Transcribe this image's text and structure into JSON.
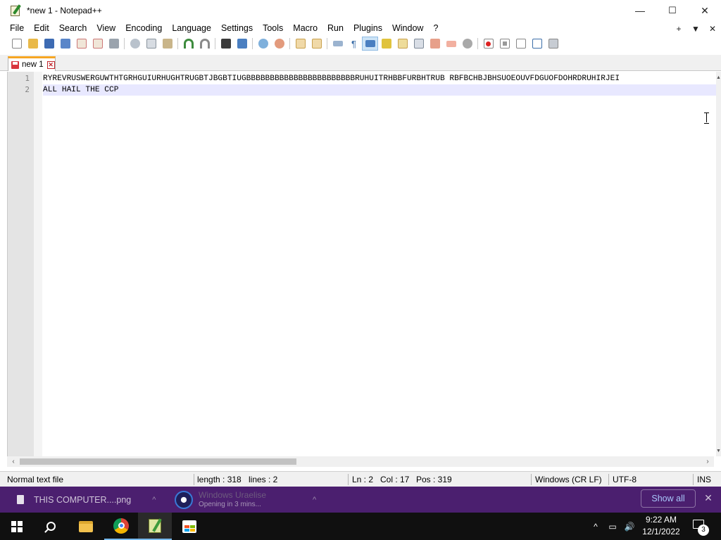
{
  "window": {
    "title": "*new 1 - Notepad++",
    "controls": {
      "minimize": "—",
      "maximize": "☐",
      "close": "✕"
    }
  },
  "menu": {
    "items": [
      "File",
      "Edit",
      "Search",
      "View",
      "Encoding",
      "Language",
      "Settings",
      "Tools",
      "Macro",
      "Run",
      "Plugins",
      "Window",
      "?"
    ],
    "right": {
      "add": "+",
      "dropdown": "▼",
      "close": "✕"
    }
  },
  "toolbar": {
    "icons": [
      "new-file",
      "open-file",
      "save",
      "save-all",
      "close",
      "close-all",
      "print",
      "cut",
      "copy",
      "paste",
      "undo",
      "redo",
      "find",
      "replace",
      "zoom-in",
      "zoom-out",
      "sync-vertical",
      "sync-horizontal",
      "word-wrap",
      "show-all-chars",
      "indent-guide",
      "user-defined-language",
      "doc-map",
      "function-list",
      "folder-as-workspace",
      "monitoring",
      "record-macro",
      "stop-recording",
      "playback",
      "run-macro-multiple",
      "save-macro"
    ],
    "active_icon": "indent-guide"
  },
  "tabs": [
    {
      "label": "new 1",
      "close": "✕"
    }
  ],
  "editor": {
    "lines": [
      {
        "number": "1",
        "text": "RYREVRUSWERGUWTHTGRHGUIURHUGHTRUGBTJBGBTIUGBBBBBBBBBBBBBBBBBBBBBBBRUHUITRHBBFURBHTRUB RBFBCHBJBHSUOEOUVFDGUOFDOHRDRUHIRJEI"
      },
      {
        "number": "2",
        "text": "ALL HAIL THE CCP"
      }
    ],
    "current_line": 2
  },
  "status": {
    "file_type": "Normal text file",
    "length": "length : 318",
    "lines": "lines : 2",
    "ln": "Ln : 2",
    "col": "Col : 17",
    "pos": "Pos : 319",
    "eol": "Windows (CR LF)",
    "encoding": "UTF-8",
    "mode": "INS"
  },
  "downloads": {
    "file_name": "THIS COMPUTER....png",
    "update_title": "Windows Uraelise",
    "update_status": "Opening in 3 mins...",
    "show_all": "Show all",
    "close": "✕",
    "caret": "^"
  },
  "taskbar": {
    "time": "9:22 AM",
    "date": "12/1/2022",
    "notification_count": "3",
    "tray_chevron": "^",
    "tray_network": "▭",
    "tray_volume": "🔊"
  },
  "colors": {
    "tab_accent": "#f6a623",
    "current_line": "#e8e8ff",
    "download_bar": "#4b1f6f",
    "taskbar": "#101010"
  }
}
